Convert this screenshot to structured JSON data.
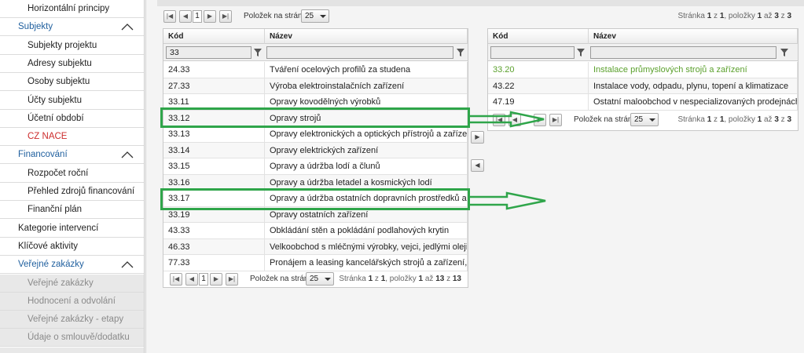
{
  "sidebar": {
    "items": [
      {
        "label": "Horizontální principy",
        "kind": "sub"
      },
      {
        "label": "Subjekty",
        "kind": "section"
      },
      {
        "label": "Subjekty projektu",
        "kind": "sub"
      },
      {
        "label": "Adresy subjektu",
        "kind": "sub"
      },
      {
        "label": "Osoby subjektu",
        "kind": "sub"
      },
      {
        "label": "Účty subjektu",
        "kind": "sub"
      },
      {
        "label": "Účetní období",
        "kind": "sub"
      },
      {
        "label": "CZ NACE",
        "kind": "sub-active"
      },
      {
        "label": "Financování",
        "kind": "section"
      },
      {
        "label": "Rozpočet roční",
        "kind": "sub"
      },
      {
        "label": "Přehled zdrojů financování",
        "kind": "sub"
      },
      {
        "label": "Finanční plán",
        "kind": "sub"
      },
      {
        "label": "Kategorie intervencí",
        "kind": "plain"
      },
      {
        "label": "Klíčové aktivity",
        "kind": "plain"
      },
      {
        "label": "Veřejné zakázky",
        "kind": "section"
      },
      {
        "label": "Veřejné zakázky",
        "kind": "sub-grey"
      },
      {
        "label": "Hodnocení a odvolání",
        "kind": "sub-grey"
      },
      {
        "label": "Veřejné zakázky - etapy",
        "kind": "sub-grey"
      },
      {
        "label": "Údaje o smlouvě/dodatku",
        "kind": "sub-grey"
      },
      {
        "label": "",
        "kind": "sub-grey"
      }
    ]
  },
  "left_grid": {
    "pager_top": {
      "page": "1",
      "per_page_label": "Položek na stránku",
      "per_page": "25",
      "info_prefix": "Stránka",
      "info_page": "1",
      "info_of": "z",
      "info_pages": "1",
      "info_items": ", položky",
      "info_from": "1",
      "info_to_word": "až",
      "info_to": "13",
      "info_z": "z",
      "info_total": "13"
    },
    "columns": [
      "Kód",
      "Název"
    ],
    "filter_value": "33",
    "rows": [
      [
        "24.33",
        "Tváření ocelových profilů za studena"
      ],
      [
        "27.33",
        "Výroba elektroinstalačních zařízení"
      ],
      [
        "33.11",
        "Opravy kovodělných výrobků"
      ],
      [
        "33.12",
        "Opravy strojů"
      ],
      [
        "33.13",
        "Opravy elektronických a optických přístrojů a zařízení"
      ],
      [
        "33.14",
        "Opravy elektrických zařízení"
      ],
      [
        "33.15",
        "Opravy a údržba lodí a člunů"
      ],
      [
        "33.16",
        "Opravy a údržba letadel a kosmických lodí"
      ],
      [
        "33.17",
        "Opravy a údržba ostatních dopravních prostředků a zaříz..."
      ],
      [
        "33.19",
        "Opravy ostatních zařízení"
      ],
      [
        "43.33",
        "Obkládání stěn a pokládání podlahových krytin"
      ],
      [
        "46.33",
        "Velkoobchod s mléčnými výrobky, vejci, jedlými oleji a tuky"
      ],
      [
        "77.33",
        "Pronájem a leasing kancelářských strojů a zařízení, včetn..."
      ]
    ]
  },
  "top_pager_info": {
    "prefix": "Stránka",
    "page": "1",
    "of": "z",
    "pages": "1",
    "items": ", položky",
    "from": "1",
    "to_word": "až",
    "to": "3",
    "z": "z",
    "total": "3"
  },
  "right_grid": {
    "columns": [
      "Kód",
      "Název"
    ],
    "filter_value": "",
    "rows": [
      [
        "33.20",
        "Instalace průmyslových strojů a zařízení"
      ],
      [
        "43.22",
        "Instalace vody, odpadu, plynu, topení a klimatizace"
      ],
      [
        "47.19",
        "Ostatní maloobchod v nespecializovaných prodejnách"
      ]
    ],
    "pager": {
      "per_page_label": "Položek na stránku",
      "per_page": "25",
      "info_prefix": "Stránka",
      "info_page": "1",
      "info_of": "z",
      "info_pages": "1",
      "info_items": ", položky",
      "info_from": "1",
      "info_to_word": "až",
      "info_to": "3",
      "info_z": "z",
      "info_total": "3"
    }
  },
  "colors": {
    "accent_blue": "#1f5f9e",
    "active_red": "#cc2b2b",
    "highlight_green": "#2fa54a",
    "added_row_green": "#5aa02c"
  },
  "icons": {
    "first": "first-page-icon",
    "prev": "prev-page-icon",
    "next": "next-page-icon",
    "last": "last-page-icon",
    "filter": "filter-funnel-icon",
    "collapse": "chevron-up-icon",
    "move_right": "move-right-icon",
    "move_left": "move-left-icon"
  }
}
